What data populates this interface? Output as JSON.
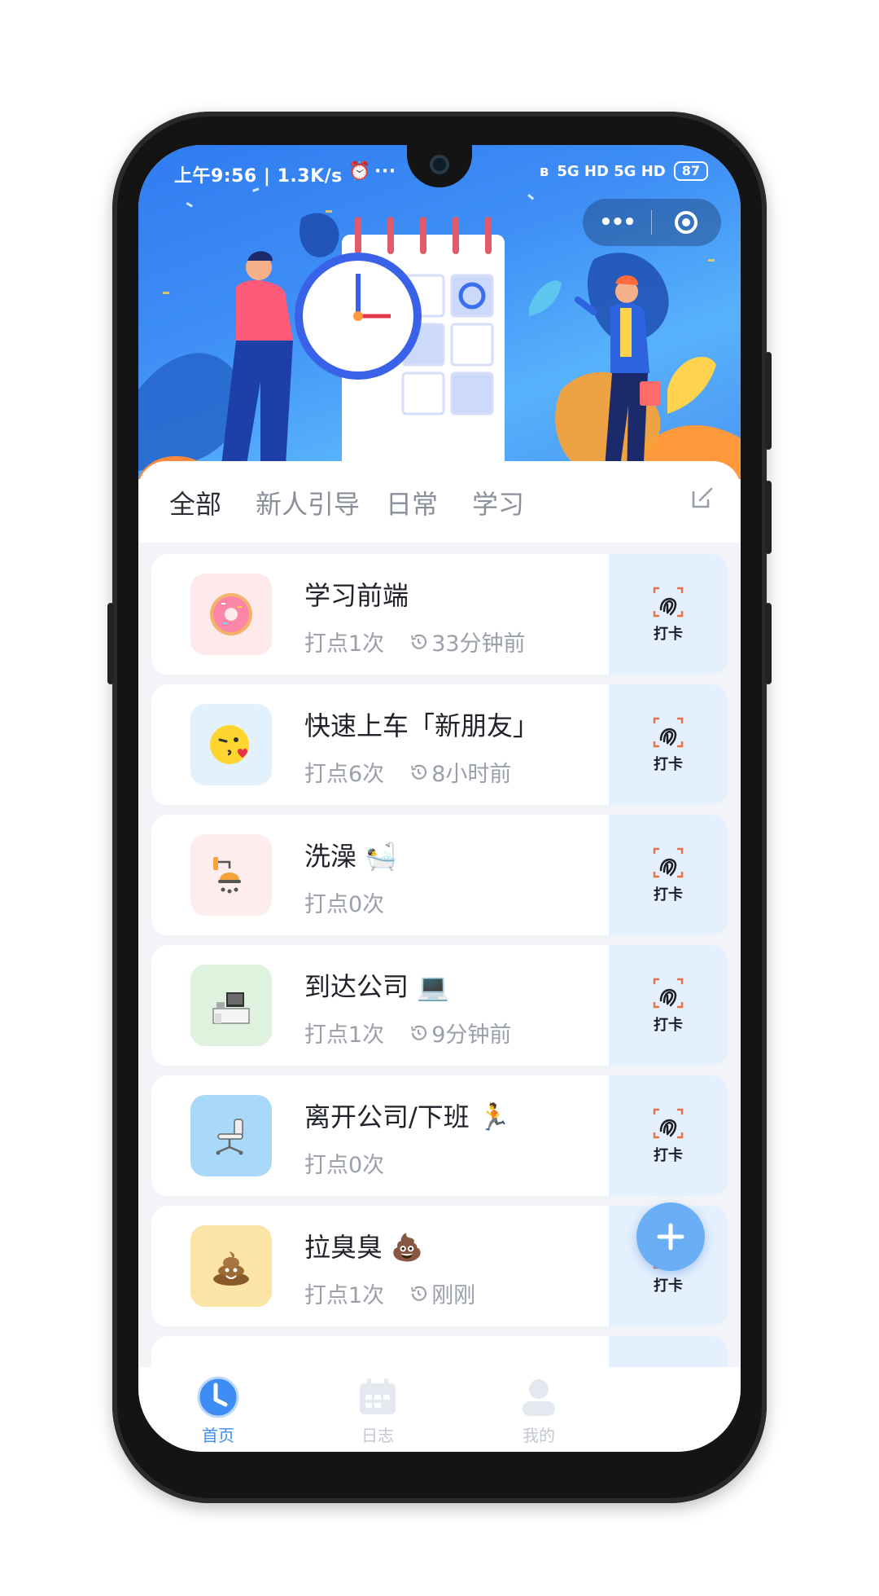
{
  "status_bar": {
    "time_speed": "上午9:56 | 1.3K/s",
    "more": "···",
    "network": "5G HD 5G HD",
    "battery": "87"
  },
  "tabs": [
    {
      "label": "全部",
      "active": true
    },
    {
      "label": "新人引导",
      "active": false
    },
    {
      "label": "日常",
      "active": false
    },
    {
      "label": "学习",
      "active": false
    }
  ],
  "tasks": [
    {
      "title": "学习前端",
      "count": "打点1次",
      "time": "33分钟前",
      "icon": "donut-icon",
      "icon_bg": "#fde8ea"
    },
    {
      "title": "快速上车「新朋友」",
      "count": "打点6次",
      "time": "8小时前",
      "icon": "kiss-emoji-icon",
      "icon_bg": "#e3f1fd"
    },
    {
      "title": "洗澡 🛀",
      "count": "打点0次",
      "time": "",
      "icon": "shower-icon",
      "icon_bg": "#fdeded"
    },
    {
      "title": "到达公司 💻",
      "count": "打点1次",
      "time": "9分钟前",
      "icon": "office-desk-icon",
      "icon_bg": "#dff2dd"
    },
    {
      "title": "离开公司/下班 🏃",
      "count": "打点0次",
      "time": "",
      "icon": "office-chair-icon",
      "icon_bg": "#a9d9f8"
    },
    {
      "title": "拉臭臭 💩",
      "count": "打点1次",
      "time": "刚刚",
      "icon": "poop-icon",
      "icon_bg": "#fbe4a6"
    }
  ],
  "checkin_label": "打卡",
  "nav": [
    {
      "label": "首页",
      "active": true
    },
    {
      "label": "日志",
      "active": false
    },
    {
      "label": "我的",
      "active": false
    }
  ],
  "colors": {
    "accent": "#3d8df5",
    "checkin_bg": "#e4f0fd",
    "fab": "#6aaef6"
  }
}
